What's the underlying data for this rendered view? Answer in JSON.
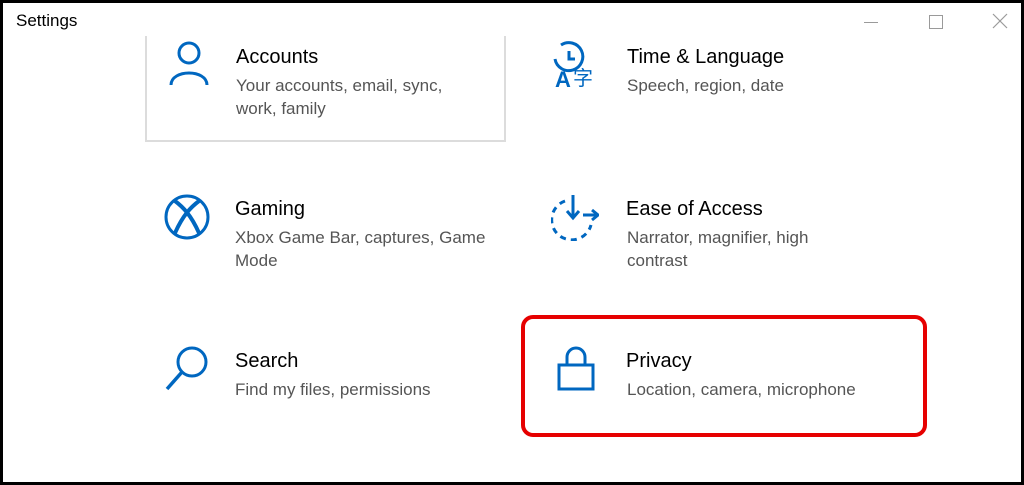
{
  "window": {
    "title": "Settings",
    "controls": {
      "minimize": "minimize-icon",
      "maximize": "maximize-icon",
      "close": "close-icon"
    }
  },
  "colors": {
    "accent": "#0067c0",
    "highlight": "#e60000"
  },
  "tiles": [
    {
      "name": "Accounts",
      "desc": "Your accounts, email, sync, work, family",
      "icon": "person-icon"
    },
    {
      "name": "Time & Language",
      "desc": "Speech, region, date",
      "icon": "time-language-icon"
    },
    {
      "name": "Gaming",
      "desc": "Xbox Game Bar, captures, Game Mode",
      "icon": "xbox-icon"
    },
    {
      "name": "Ease of Access",
      "desc": "Narrator, magnifier, high contrast",
      "icon": "ease-of-access-icon"
    },
    {
      "name": "Search",
      "desc": "Find my files, permissions",
      "icon": "search-icon"
    },
    {
      "name": "Privacy",
      "desc": "Location, camera, microphone",
      "icon": "lock-icon"
    }
  ]
}
